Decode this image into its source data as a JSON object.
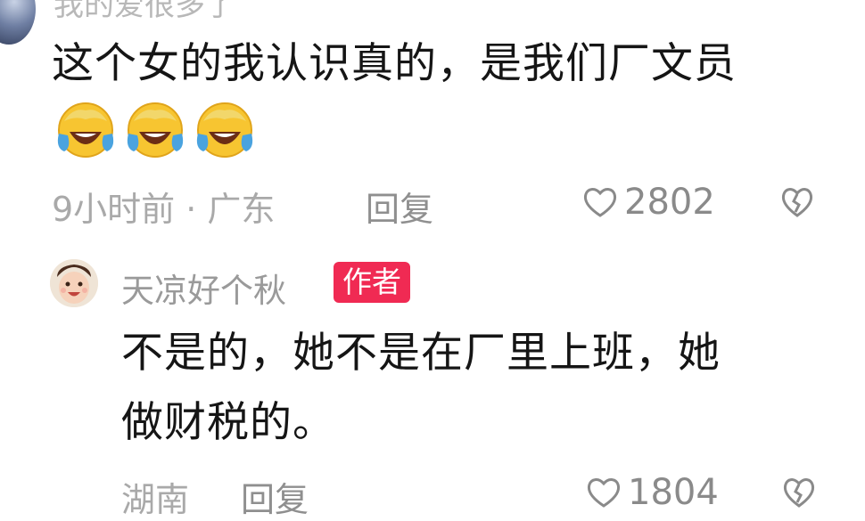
{
  "top_comment": {
    "username_partial": "我的爱很多了",
    "text": "这个女的我认识真的，是我们厂文员",
    "emoji_names": [
      "laugh-cry-emoji",
      "laugh-cry-emoji",
      "laugh-cry-emoji"
    ],
    "time_location": "9小时前 · 广东",
    "reply_label": "回复",
    "like_count": "2802"
  },
  "reply_comment": {
    "username": "天凉好个秋",
    "badge": "作者",
    "text_line1": "不是的，她不是在厂里上班，她",
    "text_line2": "做财税的。",
    "location": "湖南",
    "reply_label": "回复",
    "like_count": "1804"
  },
  "colors": {
    "badge_bg": "#f02a53",
    "text": "#151515",
    "meta": "#a9a9a9"
  },
  "icons": [
    "heart-outline-icon",
    "broken-heart-icon"
  ]
}
